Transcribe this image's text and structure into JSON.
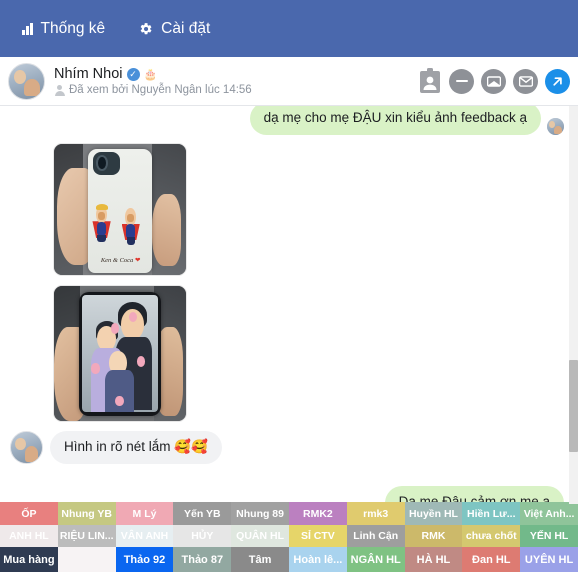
{
  "topbar": {
    "background": "#4a68ad",
    "items": [
      {
        "label": "Thống kê",
        "icon": "bar-chart-icon"
      },
      {
        "label": "Cài đặt",
        "icon": "gear-icon"
      }
    ]
  },
  "conversation_header": {
    "name": "Nhím Nhoi",
    "verified_badge": "✓",
    "cake_icon": "🎂",
    "seen_status": "Đã xem bởi Nguyễn Ngân lúc 14:56",
    "actions": [
      {
        "name": "contact-card-icon",
        "glyph": ""
      },
      {
        "name": "minus-circle-button",
        "glyph": "—"
      },
      {
        "name": "archive-circle-button",
        "glyph": "✉"
      },
      {
        "name": "envelope-circle-button",
        "glyph": "✉"
      },
      {
        "name": "send-arrow-button",
        "glyph": "↗",
        "color": "#1b8fe8"
      }
    ]
  },
  "messages": [
    {
      "type": "text",
      "direction": "out",
      "text": "dạ mẹ cho mẹ ĐẬU xin kiểu ảnh feedback ạ",
      "bubble_color": "#d9f2c6"
    },
    {
      "type": "image",
      "direction": "in",
      "alt": "phone case with two cartoon superhero babies",
      "caption": "Ken & Coca",
      "caption_heart": "❤"
    },
    {
      "type": "image",
      "direction": "in",
      "alt": "phone case with family photo of mother and two children"
    },
    {
      "type": "text",
      "direction": "in",
      "text": "Hình in rõ nét lắm 🥰🥰",
      "bubble_color": "#f1f2f4"
    },
    {
      "type": "text",
      "direction": "out",
      "text": "Dạ mẹ Đậu cảm ơn mẹ ạ",
      "bubble_color": "#d9f2c6"
    }
  ],
  "tag_bar": {
    "rows": [
      [
        {
          "label": "ỐP",
          "color": "#e8807f"
        },
        {
          "label": "Nhung YB",
          "color": "#c5c882"
        },
        {
          "label": "M Lý",
          "color": "#f0a9b4"
        },
        {
          "label": "Yến YB",
          "color": "#9a9a9a"
        },
        {
          "label": "Nhung 89",
          "color": "#a1a1a1"
        },
        {
          "label": "RMK2",
          "color": "#bb80c0"
        },
        {
          "label": "rmk3",
          "color": "#e0cb6e"
        },
        {
          "label": "Huyền HL",
          "color": "#9fb9b6"
        },
        {
          "label": "Hiền Lư...",
          "color": "#7ec5c2"
        },
        {
          "label": "Việt Anh...",
          "color": "#8fc49a"
        }
      ],
      [
        {
          "label": "ANH HL",
          "color": "#efe9ea"
        },
        {
          "label": "RIỆU LIN...",
          "color": "#bcbcbc"
        },
        {
          "label": "VÂN ANH",
          "color": "#e6eef1"
        },
        {
          "label": "HỦY",
          "color": "#e6e6e6"
        },
        {
          "label": "QUÂN HL",
          "color": "#dfe7df"
        },
        {
          "label": "SỈ CTV",
          "color": "#e6d569"
        },
        {
          "label": "Linh Cận",
          "color": "#9e9e9e"
        },
        {
          "label": "RMK",
          "color": "#ccb96a"
        },
        {
          "label": "chưa chốt",
          "color": "#d4c86f"
        },
        {
          "label": "YẾN HL",
          "color": "#72b98a"
        }
      ],
      [
        {
          "label": "Mua hàng",
          "color": "#2f3b52"
        },
        {
          "label": "",
          "color": "#f7f3f4"
        },
        {
          "label": "Thảo 92",
          "color": "#0a66f0"
        },
        {
          "label": "Thảo 87",
          "color": "#92a8a1"
        },
        {
          "label": "Tâm",
          "color": "#8a8a8a"
        },
        {
          "label": "Hoàn lê...",
          "color": "#a9d3ee"
        },
        {
          "label": "NGÂN HL",
          "color": "#7fc283"
        },
        {
          "label": "HÀ HL",
          "color": "#c08a84"
        },
        {
          "label": "Đan HL",
          "color": "#dd7b72"
        },
        {
          "label": "UYÊN HL",
          "color": "#9aa1e8"
        }
      ]
    ]
  }
}
